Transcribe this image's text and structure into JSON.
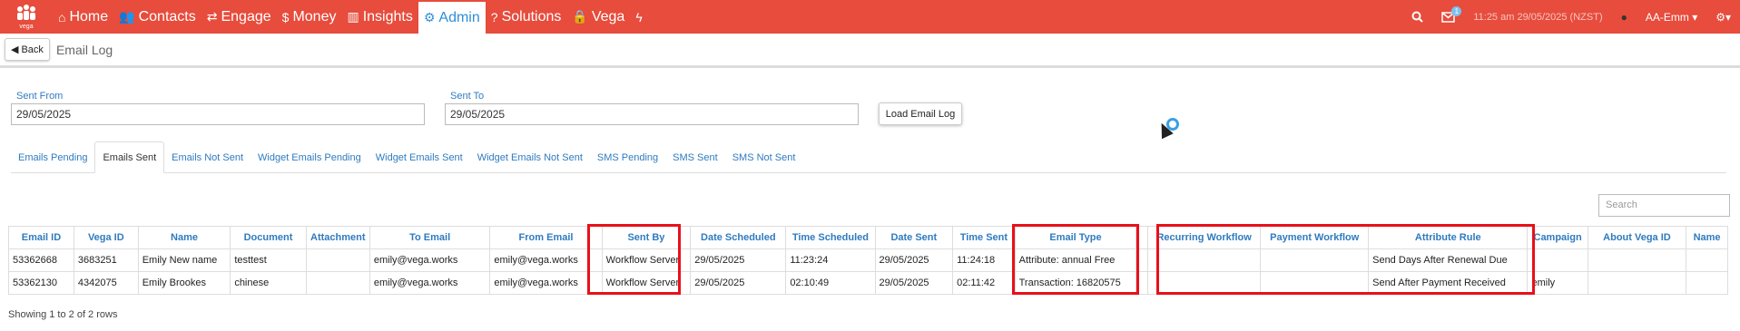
{
  "nav": {
    "items": [
      {
        "label": "Home",
        "icon": "home-icon",
        "glyph": "⌂"
      },
      {
        "label": "Contacts",
        "icon": "users-icon",
        "glyph": "👥"
      },
      {
        "label": "Engage",
        "icon": "exchange-icon",
        "glyph": "⇄"
      },
      {
        "label": "Money",
        "icon": "dollar-icon",
        "glyph": "$"
      },
      {
        "label": "Insights",
        "icon": "bar-chart-icon",
        "glyph": "▥"
      },
      {
        "label": "Admin",
        "icon": "cogs-icon",
        "glyph": "⚙"
      },
      {
        "label": "Solutions",
        "icon": "question-icon",
        "glyph": "?"
      },
      {
        "label": "Vega",
        "icon": "lock-icon",
        "glyph": "🔒"
      },
      {
        "label": "",
        "icon": "bolt-icon",
        "glyph": "ϟ"
      }
    ],
    "datetime": "11:25 am 29/05/2025 (NZST)",
    "user": "AA-Emm",
    "mail_count": "1"
  },
  "page": {
    "back_label": "Back",
    "title": "Email Log"
  },
  "filters": {
    "sent_from_label": "Sent From",
    "sent_from_value": "29/05/2025",
    "sent_to_label": "Sent To",
    "sent_to_value": "29/05/2025",
    "load_label": "Load Email Log"
  },
  "tabs": [
    {
      "label": "Emails Pending"
    },
    {
      "label": "Emails Sent",
      "active": true
    },
    {
      "label": "Emails Not Sent"
    },
    {
      "label": "Widget Emails Pending"
    },
    {
      "label": "Widget Emails Sent"
    },
    {
      "label": "Widget Emails Not Sent"
    },
    {
      "label": "SMS Pending"
    },
    {
      "label": "SMS Sent"
    },
    {
      "label": "SMS Not Sent"
    }
  ],
  "search_placeholder": "Search",
  "table": {
    "columns": [
      "Email ID",
      "Vega ID",
      "Name",
      "Document",
      "Attachment",
      "To Email",
      "From Email",
      "Sent By",
      "Date Scheduled",
      "Time Scheduled",
      "Date Sent",
      "Time Sent",
      "Email Type",
      "",
      "Recurring Workflow",
      "Payment Workflow",
      "Attribute Rule",
      "Campaign",
      "About Vega ID",
      "Name"
    ],
    "rows": [
      [
        "53362668",
        "3683251",
        "Emily New name",
        "testtest",
        "",
        "emily@vega.works",
        "emily@vega.works",
        "Workflow Server",
        "29/05/2025",
        "11:23:24",
        "29/05/2025",
        "11:24:18",
        "Attribute: annual Free",
        "",
        "",
        "",
        "Send Days After Renewal Due",
        "",
        "",
        ""
      ],
      [
        "53362130",
        "4342075",
        "Emily Brookes",
        "chinese",
        "",
        "emily@vega.works",
        "emily@vega.works",
        "Workflow Server",
        "29/05/2025",
        "02:10:49",
        "29/05/2025",
        "02:11:42",
        "Transaction: 16820575",
        "",
        "",
        "",
        "Send After Payment Received",
        "emily",
        "",
        ""
      ]
    ]
  },
  "footer": "Showing 1 to 2 of 2 rows",
  "colors": {
    "nav_bg": "#e74c3c",
    "link": "#2f7bbf",
    "highlight": "#e8101a"
  }
}
